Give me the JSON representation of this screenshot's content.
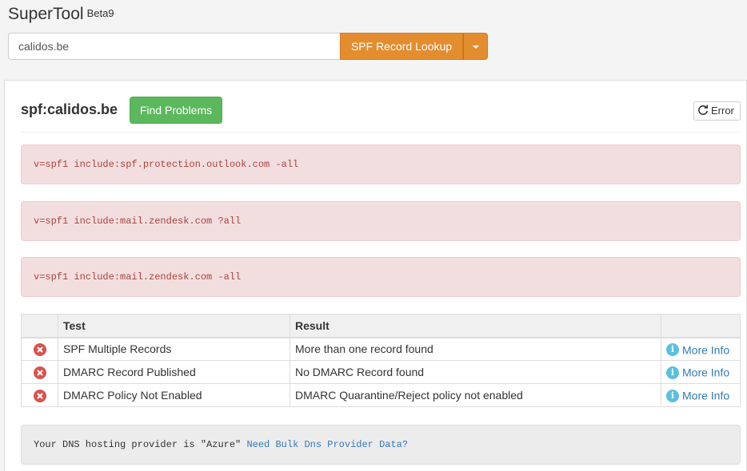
{
  "app": {
    "name": "SuperTool",
    "badge": "Beta9"
  },
  "search": {
    "value": "calidos.be",
    "placeholder": "",
    "lookup_label": "SPF Record Lookup"
  },
  "panel": {
    "title": "spf:calidos.be",
    "find_problems_label": "Find Problems",
    "error_label": "Error"
  },
  "records": [
    "v=spf1 include:spf.protection.outlook.com -all",
    "v=spf1 include:mail.zendesk.com ?all",
    "v=spf1 include:mail.zendesk.com -all"
  ],
  "results": {
    "headers": [
      "",
      "Test",
      "Result",
      ""
    ],
    "rows": [
      {
        "status": "error",
        "test": "SPF Multiple Records",
        "result": "More than one record found",
        "more": "More Info"
      },
      {
        "status": "error",
        "test": "DMARC Record Published",
        "result": "No DMARC Record found",
        "more": "More Info"
      },
      {
        "status": "error",
        "test": "DMARC Policy Not Enabled",
        "result": "DMARC Quarantine/Reject policy not enabled",
        "more": "More Info"
      }
    ]
  },
  "dns": {
    "text": "Your DNS hosting provider is \"Azure\"",
    "link": "Need Bulk Dns Provider Data?"
  },
  "colors": {
    "accent_orange": "#e38d2f",
    "success_green": "#5cb85c",
    "danger_red": "#d9534f",
    "info_blue": "#5bc0de",
    "link_blue": "#337ab7"
  }
}
